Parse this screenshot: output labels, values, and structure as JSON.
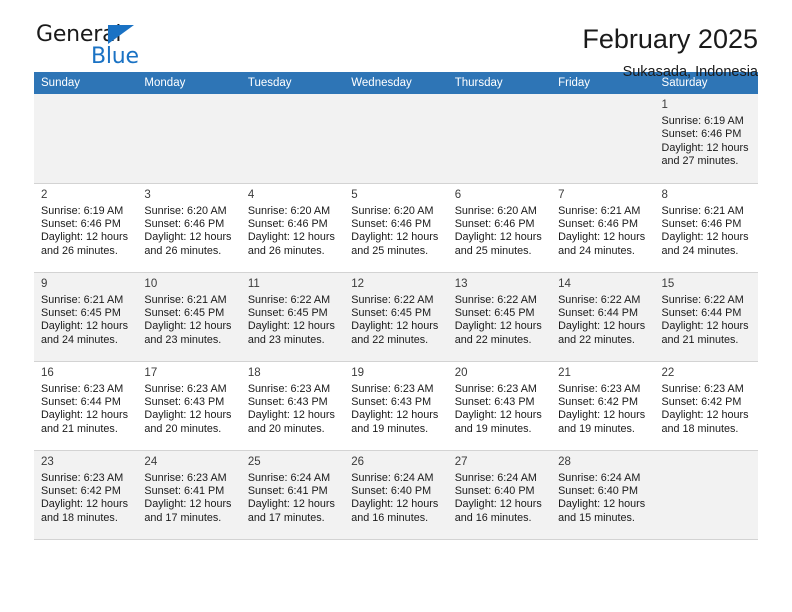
{
  "logo": {
    "word_one": "General",
    "word_two": "Blue",
    "triangle_icon": "triangle-icon"
  },
  "header": {
    "title": "February 2025",
    "subtitle": "Sukasada, Indonesia"
  },
  "calendar": {
    "weekday_headers": [
      "Sunday",
      "Monday",
      "Tuesday",
      "Wednesday",
      "Thursday",
      "Friday",
      "Saturday"
    ],
    "header_bg": "#2e75b6",
    "shaded_row_bg": "#f2f2f2",
    "labels": {
      "sunrise": "Sunrise:",
      "sunset": "Sunset:",
      "daylight": "Daylight:"
    },
    "weeks": [
      [
        null,
        null,
        null,
        null,
        null,
        null,
        {
          "day": "1",
          "sunrise": "Sunrise: 6:19 AM",
          "sunset": "Sunset: 6:46 PM",
          "daylight_line1": "Daylight: 12 hours",
          "daylight_line2": "and 27 minutes."
        }
      ],
      [
        {
          "day": "2",
          "sunrise": "Sunrise: 6:19 AM",
          "sunset": "Sunset: 6:46 PM",
          "daylight_line1": "Daylight: 12 hours",
          "daylight_line2": "and 26 minutes."
        },
        {
          "day": "3",
          "sunrise": "Sunrise: 6:20 AM",
          "sunset": "Sunset: 6:46 PM",
          "daylight_line1": "Daylight: 12 hours",
          "daylight_line2": "and 26 minutes."
        },
        {
          "day": "4",
          "sunrise": "Sunrise: 6:20 AM",
          "sunset": "Sunset: 6:46 PM",
          "daylight_line1": "Daylight: 12 hours",
          "daylight_line2": "and 26 minutes."
        },
        {
          "day": "5",
          "sunrise": "Sunrise: 6:20 AM",
          "sunset": "Sunset: 6:46 PM",
          "daylight_line1": "Daylight: 12 hours",
          "daylight_line2": "and 25 minutes."
        },
        {
          "day": "6",
          "sunrise": "Sunrise: 6:20 AM",
          "sunset": "Sunset: 6:46 PM",
          "daylight_line1": "Daylight: 12 hours",
          "daylight_line2": "and 25 minutes."
        },
        {
          "day": "7",
          "sunrise": "Sunrise: 6:21 AM",
          "sunset": "Sunset: 6:46 PM",
          "daylight_line1": "Daylight: 12 hours",
          "daylight_line2": "and 24 minutes."
        },
        {
          "day": "8",
          "sunrise": "Sunrise: 6:21 AM",
          "sunset": "Sunset: 6:46 PM",
          "daylight_line1": "Daylight: 12 hours",
          "daylight_line2": "and 24 minutes."
        }
      ],
      [
        {
          "day": "9",
          "sunrise": "Sunrise: 6:21 AM",
          "sunset": "Sunset: 6:45 PM",
          "daylight_line1": "Daylight: 12 hours",
          "daylight_line2": "and 24 minutes."
        },
        {
          "day": "10",
          "sunrise": "Sunrise: 6:21 AM",
          "sunset": "Sunset: 6:45 PM",
          "daylight_line1": "Daylight: 12 hours",
          "daylight_line2": "and 23 minutes."
        },
        {
          "day": "11",
          "sunrise": "Sunrise: 6:22 AM",
          "sunset": "Sunset: 6:45 PM",
          "daylight_line1": "Daylight: 12 hours",
          "daylight_line2": "and 23 minutes."
        },
        {
          "day": "12",
          "sunrise": "Sunrise: 6:22 AM",
          "sunset": "Sunset: 6:45 PM",
          "daylight_line1": "Daylight: 12 hours",
          "daylight_line2": "and 22 minutes."
        },
        {
          "day": "13",
          "sunrise": "Sunrise: 6:22 AM",
          "sunset": "Sunset: 6:45 PM",
          "daylight_line1": "Daylight: 12 hours",
          "daylight_line2": "and 22 minutes."
        },
        {
          "day": "14",
          "sunrise": "Sunrise: 6:22 AM",
          "sunset": "Sunset: 6:44 PM",
          "daylight_line1": "Daylight: 12 hours",
          "daylight_line2": "and 22 minutes."
        },
        {
          "day": "15",
          "sunrise": "Sunrise: 6:22 AM",
          "sunset": "Sunset: 6:44 PM",
          "daylight_line1": "Daylight: 12 hours",
          "daylight_line2": "and 21 minutes."
        }
      ],
      [
        {
          "day": "16",
          "sunrise": "Sunrise: 6:23 AM",
          "sunset": "Sunset: 6:44 PM",
          "daylight_line1": "Daylight: 12 hours",
          "daylight_line2": "and 21 minutes."
        },
        {
          "day": "17",
          "sunrise": "Sunrise: 6:23 AM",
          "sunset": "Sunset: 6:43 PM",
          "daylight_line1": "Daylight: 12 hours",
          "daylight_line2": "and 20 minutes."
        },
        {
          "day": "18",
          "sunrise": "Sunrise: 6:23 AM",
          "sunset": "Sunset: 6:43 PM",
          "daylight_line1": "Daylight: 12 hours",
          "daylight_line2": "and 20 minutes."
        },
        {
          "day": "19",
          "sunrise": "Sunrise: 6:23 AM",
          "sunset": "Sunset: 6:43 PM",
          "daylight_line1": "Daylight: 12 hours",
          "daylight_line2": "and 19 minutes."
        },
        {
          "day": "20",
          "sunrise": "Sunrise: 6:23 AM",
          "sunset": "Sunset: 6:43 PM",
          "daylight_line1": "Daylight: 12 hours",
          "daylight_line2": "and 19 minutes."
        },
        {
          "day": "21",
          "sunrise": "Sunrise: 6:23 AM",
          "sunset": "Sunset: 6:42 PM",
          "daylight_line1": "Daylight: 12 hours",
          "daylight_line2": "and 19 minutes."
        },
        {
          "day": "22",
          "sunrise": "Sunrise: 6:23 AM",
          "sunset": "Sunset: 6:42 PM",
          "daylight_line1": "Daylight: 12 hours",
          "daylight_line2": "and 18 minutes."
        }
      ],
      [
        {
          "day": "23",
          "sunrise": "Sunrise: 6:23 AM",
          "sunset": "Sunset: 6:42 PM",
          "daylight_line1": "Daylight: 12 hours",
          "daylight_line2": "and 18 minutes."
        },
        {
          "day": "24",
          "sunrise": "Sunrise: 6:23 AM",
          "sunset": "Sunset: 6:41 PM",
          "daylight_line1": "Daylight: 12 hours",
          "daylight_line2": "and 17 minutes."
        },
        {
          "day": "25",
          "sunrise": "Sunrise: 6:24 AM",
          "sunset": "Sunset: 6:41 PM",
          "daylight_line1": "Daylight: 12 hours",
          "daylight_line2": "and 17 minutes."
        },
        {
          "day": "26",
          "sunrise": "Sunrise: 6:24 AM",
          "sunset": "Sunset: 6:40 PM",
          "daylight_line1": "Daylight: 12 hours",
          "daylight_line2": "and 16 minutes."
        },
        {
          "day": "27",
          "sunrise": "Sunrise: 6:24 AM",
          "sunset": "Sunset: 6:40 PM",
          "daylight_line1": "Daylight: 12 hours",
          "daylight_line2": "and 16 minutes."
        },
        {
          "day": "28",
          "sunrise": "Sunrise: 6:24 AM",
          "sunset": "Sunset: 6:40 PM",
          "daylight_line1": "Daylight: 12 hours",
          "daylight_line2": "and 15 minutes."
        },
        null
      ]
    ]
  }
}
